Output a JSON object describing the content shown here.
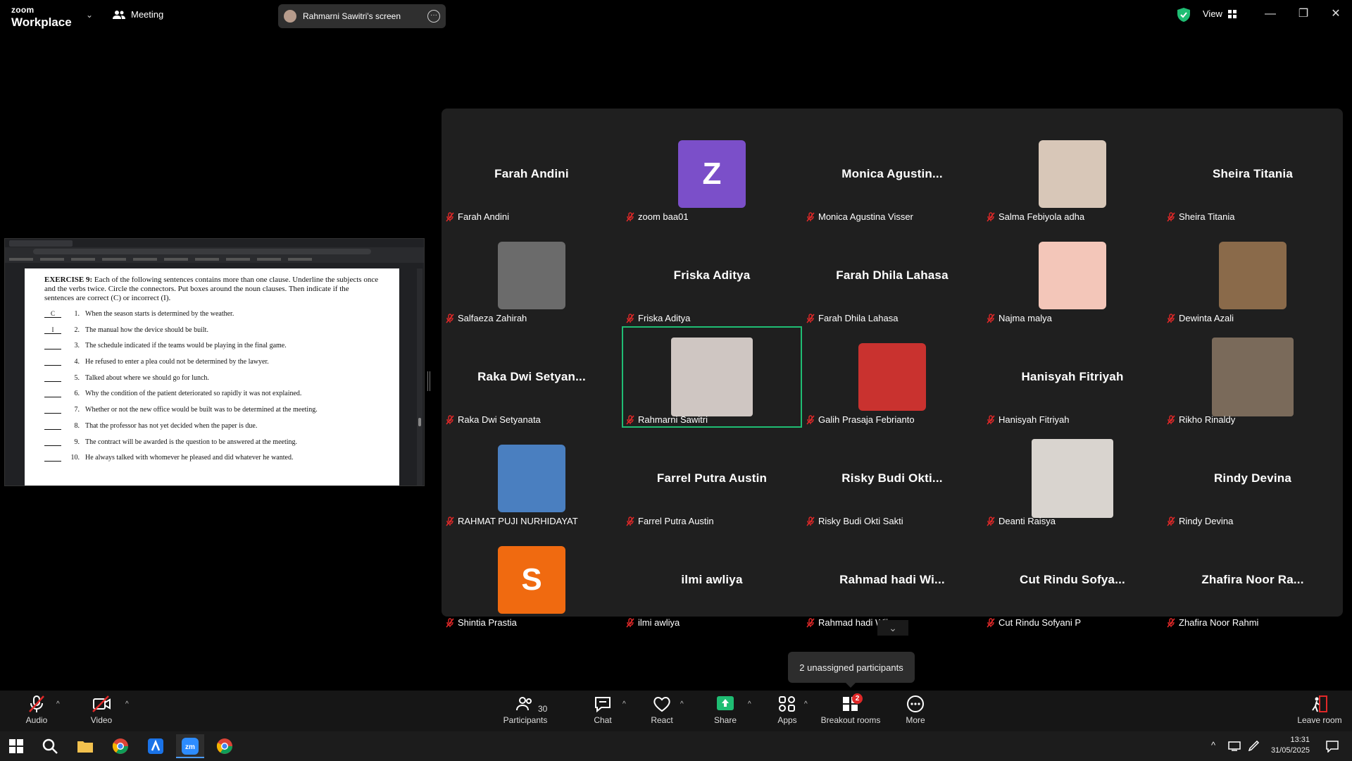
{
  "titlebar": {
    "logo_line1": "zoom",
    "logo_line2": "Workplace",
    "meeting_label": "Meeting",
    "screen_tab_label": "Rahmarni Sawitri's screen",
    "view_label": "View"
  },
  "shared_screen": {
    "exercise_title": "EXERCISE 9:",
    "instructions": "Each of the following sentences contains more than one clause. Underline the subjects once and the verbs twice. Circle the connectors. Put boxes around the noun clauses. Then indicate if the sentences are correct (C) or incorrect (I).",
    "items": [
      {
        "num": "1.",
        "answer": "C",
        "text": "When the season starts is determined by the weather."
      },
      {
        "num": "2.",
        "answer": "I",
        "text": "The manual how the device should be built."
      },
      {
        "num": "3.",
        "answer": "",
        "text": "The schedule indicated if the teams would be playing in the final game."
      },
      {
        "num": "4.",
        "answer": "",
        "text": "He refused to enter a plea could not be determined by the lawyer."
      },
      {
        "num": "5.",
        "answer": "",
        "text": "Talked about where we should go for lunch."
      },
      {
        "num": "6.",
        "answer": "",
        "text": "Why the condition of the patient deteriorated so rapidly it was not explained."
      },
      {
        "num": "7.",
        "answer": "",
        "text": "Whether or not the new office would be built was to be determined at the meeting."
      },
      {
        "num": "8.",
        "answer": "",
        "text": "That the professor has not yet decided when the paper is due."
      },
      {
        "num": "9.",
        "answer": "",
        "text": "The contract will be awarded is the question to be answered at the meeting."
      },
      {
        "num": "10.",
        "answer": "",
        "text": "He always talked with whomever he pleased and did whatever he wanted."
      }
    ]
  },
  "participants": [
    {
      "name": "Farah Andini",
      "display": "Farah Andini",
      "type": "name"
    },
    {
      "name": "zoom baa01",
      "display": "Z",
      "type": "letter",
      "color": "#7b4fc9"
    },
    {
      "name": "Monica Agustina Visser",
      "display": "Monica  Agustin...",
      "type": "name"
    },
    {
      "name": "Salma Febiyola adha",
      "display": "",
      "type": "photo",
      "color": "#d8c7b8"
    },
    {
      "name": "Sheira Titania",
      "display": "Sheira Titania",
      "type": "name"
    },
    {
      "name": "Salfaeza Zahirah",
      "display": "",
      "type": "photo",
      "color": "#6b6b6b"
    },
    {
      "name": "Friska Aditya",
      "display": "Friska Aditya",
      "type": "name"
    },
    {
      "name": "Farah Dhila Lahasa",
      "display": "Farah Dhila Lahasa",
      "type": "name"
    },
    {
      "name": "Najma malya",
      "display": "",
      "type": "photo",
      "color": "#f3c6b9"
    },
    {
      "name": "Dewinta Azali",
      "display": "",
      "type": "photo",
      "color": "#8a6a4a"
    },
    {
      "name": "Raka Dwi Setyanata",
      "display": "Raka  Dwi  Setyan...",
      "type": "name"
    },
    {
      "name": "Rahmarni Sawitri",
      "display": "",
      "type": "video",
      "color": "#cfc6c2"
    },
    {
      "name": "Galih Prasaja Febrianto",
      "display": "",
      "type": "photo",
      "color": "#c9322f"
    },
    {
      "name": "Hanisyah Fitriyah",
      "display": "Hanisyah Fitriyah",
      "type": "name"
    },
    {
      "name": "Rikho Rinaldy",
      "display": "",
      "type": "video",
      "color": "#7a6a5a"
    },
    {
      "name": "RAHMAT PUJI NURHIDAYAT",
      "display": "",
      "type": "photo",
      "color": "#4a7fc0"
    },
    {
      "name": "Farrel Putra Austin",
      "display": "Farrel Putra Austin",
      "type": "name"
    },
    {
      "name": "Risky Budi Okti Sakti",
      "display": "Risky  Budi  Okti...",
      "type": "name"
    },
    {
      "name": "Deanti Raisya",
      "display": "",
      "type": "video",
      "color": "#d9d4cf"
    },
    {
      "name": "Rindy Devina",
      "display": "Rindy Devina",
      "type": "name"
    },
    {
      "name": "Shintia Prastia",
      "display": "S",
      "type": "letter",
      "color": "#f06a10"
    },
    {
      "name": "ilmi awliya",
      "display": "ilmi awliya",
      "type": "name"
    },
    {
      "name": "Rahmad hadi Wijaya",
      "display": "Rahmad  hadi  Wi...",
      "type": "name"
    },
    {
      "name": "Cut Rindu Sofyani P",
      "display": "Cut  Rindu  Sofya...",
      "type": "name"
    },
    {
      "name": "Zhafira Noor Rahmi",
      "display": "Zhafira  Noor  Ra...",
      "type": "name"
    }
  ],
  "tooltip": "2 unassigned participants",
  "toolbar": {
    "audio": "Audio",
    "video": "Video",
    "participants": "Participants",
    "participants_count": "30",
    "chat": "Chat",
    "react": "React",
    "share": "Share",
    "apps": "Apps",
    "breakout": "Breakout rooms",
    "breakout_badge": "2",
    "more": "More",
    "leave": "Leave room"
  },
  "taskbar": {
    "time": "13:31",
    "date": "31/05/2025"
  },
  "colors": {
    "active_speaker": "#1fbd73",
    "share_green": "#1fbd73",
    "muted_red": "#e02828"
  }
}
